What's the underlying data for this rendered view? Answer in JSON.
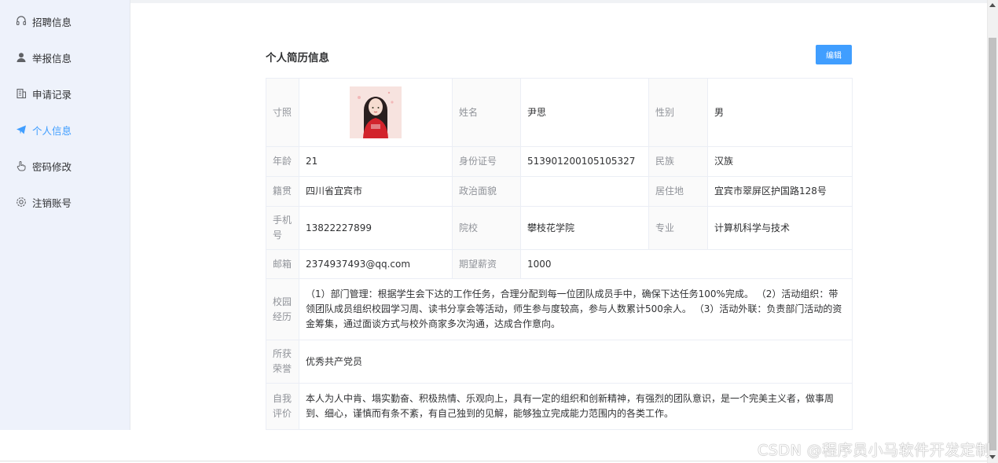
{
  "sidebar": {
    "items": [
      {
        "label": "招聘信息",
        "icon": "headset-icon"
      },
      {
        "label": "举报信息",
        "icon": "user-icon"
      },
      {
        "label": "申请记录",
        "icon": "building-icon"
      },
      {
        "label": "个人信息",
        "icon": "send-icon"
      },
      {
        "label": "密码修改",
        "icon": "hand-pointer-icon"
      },
      {
        "label": "注销账号",
        "icon": "gear-icon"
      }
    ],
    "active_index": 3
  },
  "resume": {
    "title": "个人简历信息",
    "edit_label": "编辑",
    "photo_label": "寸照",
    "name_label": "姓名",
    "name": "尹思",
    "gender_label": "性别",
    "gender": "男",
    "age_label": "年龄",
    "age": "21",
    "id_label": "身份证号",
    "id_number": "513901200105105327",
    "ethnicity_label": "民族",
    "ethnicity": "汉族",
    "native_label": "籍贯",
    "native_place": "四川省宜宾市",
    "political_label": "政治面貌",
    "political": "",
    "residence_label": "居住地",
    "residence": "宜宾市翠屏区护国路128号",
    "phone_label": "手机号",
    "phone": "13822227899",
    "school_label": "院校",
    "school": "攀枝花学院",
    "major_label": "专业",
    "major": "计算机科学与技术",
    "email_label": "邮箱",
    "email": "2374937493@qq.com",
    "salary_label": "期望薪资",
    "salary": "1000",
    "campus_label": "校园经历",
    "campus": "（1）部门管理：根据学生会下达的工作任务，合理分配到每一位团队成员手中，确保下达任务100%完成。 （2）活动组织：带领团队成员组织校园学习周、读书分享会等活动，师生参与度较高，参与人数累计500余人。 （3）活动外联：负责部门活动的资金筹集，通过面谈方式与校外商家多次沟通，达成合作意向。",
    "honor_label": "所获荣誉",
    "honor": "优秀共产党员",
    "self_label": "自我评价",
    "self_eval": "本人为人中肯、塌实勤奋、积极热情、乐观向上，具有一定的组织和创新精神，有强烈的团队意识，是一个完美主义者，做事周到、细心，谨慎而有条不紊，有自己独到的见解，能够独立完成能力范围内的各类工作。"
  },
  "watermark": "CSDN @程序员小马软件开发定制",
  "colors": {
    "accent": "#409eff",
    "sidebar_bg": "#eef2fb",
    "label_bg": "#fafafa"
  }
}
